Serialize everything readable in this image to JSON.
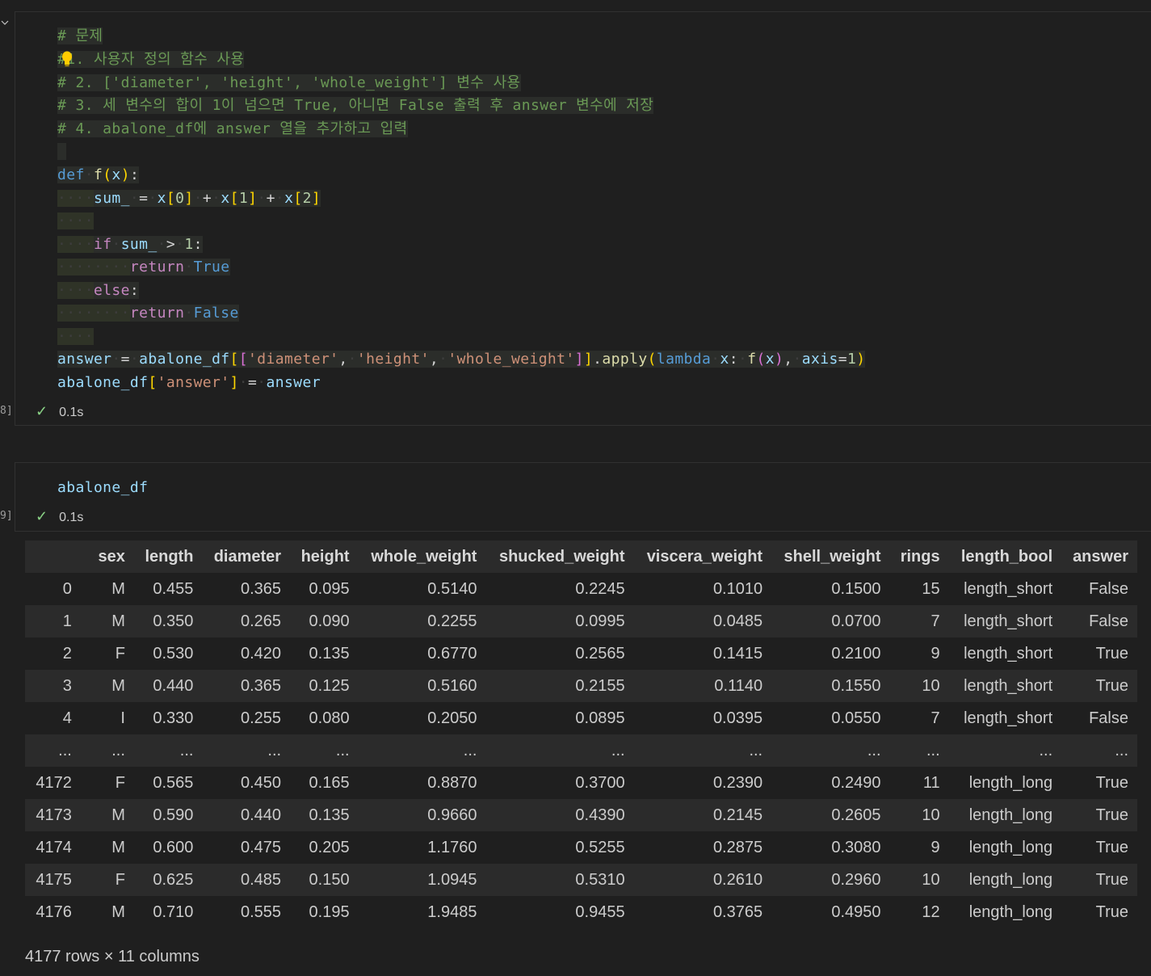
{
  "cell1": {
    "exec_count": "8]",
    "comment_lines": [
      "# 문제",
      "#1. 사용자 정의 함수 사용",
      "# 2. ['diameter', 'height', 'whole_weight'] 변수 사용",
      "# 3. 세 변수의 합이 1이 넘으면 True, 아니면 False 출력 후 answer 변수에 저장",
      "# 4. abalone_df에 answer 열을 추가하고 입력"
    ],
    "status_time": "0.1s"
  },
  "cell2": {
    "exec_count": "9]",
    "code": "abalone_df",
    "status_time": "0.1s"
  },
  "dataframe": {
    "columns": [
      "",
      "sex",
      "length",
      "diameter",
      "height",
      "whole_weight",
      "shucked_weight",
      "viscera_weight",
      "shell_weight",
      "rings",
      "length_bool",
      "answer"
    ],
    "rows": [
      [
        "0",
        "M",
        "0.455",
        "0.365",
        "0.095",
        "0.5140",
        "0.2245",
        "0.1010",
        "0.1500",
        "15",
        "length_short",
        "False"
      ],
      [
        "1",
        "M",
        "0.350",
        "0.265",
        "0.090",
        "0.2255",
        "0.0995",
        "0.0485",
        "0.0700",
        "7",
        "length_short",
        "False"
      ],
      [
        "2",
        "F",
        "0.530",
        "0.420",
        "0.135",
        "0.6770",
        "0.2565",
        "0.1415",
        "0.2100",
        "9",
        "length_short",
        "True"
      ],
      [
        "3",
        "M",
        "0.440",
        "0.365",
        "0.125",
        "0.5160",
        "0.2155",
        "0.1140",
        "0.1550",
        "10",
        "length_short",
        "True"
      ],
      [
        "4",
        "I",
        "0.330",
        "0.255",
        "0.080",
        "0.2050",
        "0.0895",
        "0.0395",
        "0.0550",
        "7",
        "length_short",
        "False"
      ],
      [
        "...",
        "...",
        "...",
        "...",
        "...",
        "...",
        "...",
        "...",
        "...",
        "...",
        "...",
        "..."
      ],
      [
        "4172",
        "F",
        "0.565",
        "0.450",
        "0.165",
        "0.8870",
        "0.3700",
        "0.2390",
        "0.2490",
        "11",
        "length_long",
        "True"
      ],
      [
        "4173",
        "M",
        "0.590",
        "0.440",
        "0.135",
        "0.9660",
        "0.4390",
        "0.2145",
        "0.2605",
        "10",
        "length_long",
        "True"
      ],
      [
        "4174",
        "M",
        "0.600",
        "0.475",
        "0.205",
        "1.1760",
        "0.5255",
        "0.2875",
        "0.3080",
        "9",
        "length_long",
        "True"
      ],
      [
        "4175",
        "F",
        "0.625",
        "0.485",
        "0.150",
        "1.0945",
        "0.5310",
        "0.2610",
        "0.2960",
        "10",
        "length_long",
        "True"
      ],
      [
        "4176",
        "M",
        "0.710",
        "0.555",
        "0.195",
        "1.9485",
        "0.9455",
        "0.3765",
        "0.4950",
        "12",
        "length_long",
        "True"
      ]
    ],
    "shape_text": "4177 rows × 11 columns"
  },
  "colors": {
    "background": "#1f1f1f",
    "comment": "#6a9955",
    "keyword": "#569cd6",
    "success": "#89d185"
  }
}
